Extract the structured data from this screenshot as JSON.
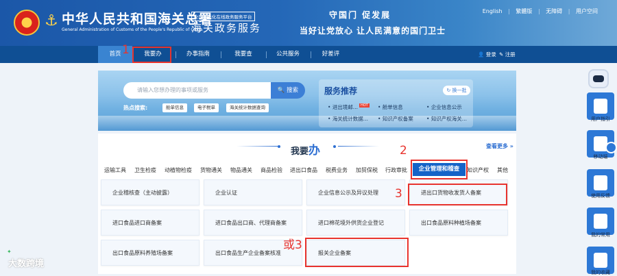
{
  "header": {
    "title_cn": "中华人民共和国海关总署",
    "title_en": "General Administration of Customs of the People's Republic of China",
    "platform_small": "全国一体化在线政务服务平台",
    "platform_big": "海关政务服务",
    "slogan1": "守国门  促发展",
    "slogan2": "当好让党放心  让人民满意的国门卫士",
    "toplinks": [
      "English",
      "繁體版",
      "无障碍",
      "用户空间"
    ]
  },
  "nav": {
    "items": [
      "首页",
      "我要办",
      "办事指南",
      "我要查",
      "公共服务",
      "好差评"
    ],
    "login": "登录",
    "register": "注册"
  },
  "hero": {
    "search_placeholder": "请输入您想办理的事项或服务",
    "search_button": "搜索",
    "hot_label": "热点搜索:",
    "hot_tags": [
      "舱单信息",
      "电子税单",
      "海关统计数据查询"
    ],
    "recommend_title": "服务推荐",
    "change_label": "换一批",
    "recommend_items": [
      "进出境邮...",
      "HOT",
      "舱单信息",
      "企业信息公示",
      "海关统计数据...",
      "知识产权备案",
      "知识产权海关..."
    ]
  },
  "section": {
    "title_prefix": "我要",
    "title_highlight": "办",
    "more": "查看更多 »",
    "categories": [
      "运输工具",
      "卫生检疫",
      "动植物检疫",
      "货物通关",
      "物品通关",
      "商品检验",
      "进出口食品",
      "税费业务",
      "加贸保税",
      "行政审批",
      "企业管理和稽查",
      "知识产权",
      "其他"
    ],
    "cards": [
      [
        "企业稽核查（主动披露）",
        "企业认证",
        "企业信息公示及异议处理",
        "进出口货物收发货人备案"
      ],
      [
        "进口食品进口商备案",
        "进口食品出口商、代理商备案",
        "进口棉花境外供货企业登记",
        "出口食品原料种植场备案"
      ],
      [
        "出口食品原料养殖场备案",
        "出口食品生产企业备案核准",
        "报关企业备案",
        ""
      ]
    ]
  },
  "annotations": {
    "n1": "1",
    "n2": "2",
    "n3": "3",
    "n3b": "或3"
  },
  "sidebar": {
    "items": [
      "用户指引",
      "移动端",
      "使用反馈",
      "我的常用",
      "我的收藏"
    ]
  },
  "watermark": "大数跨境"
}
